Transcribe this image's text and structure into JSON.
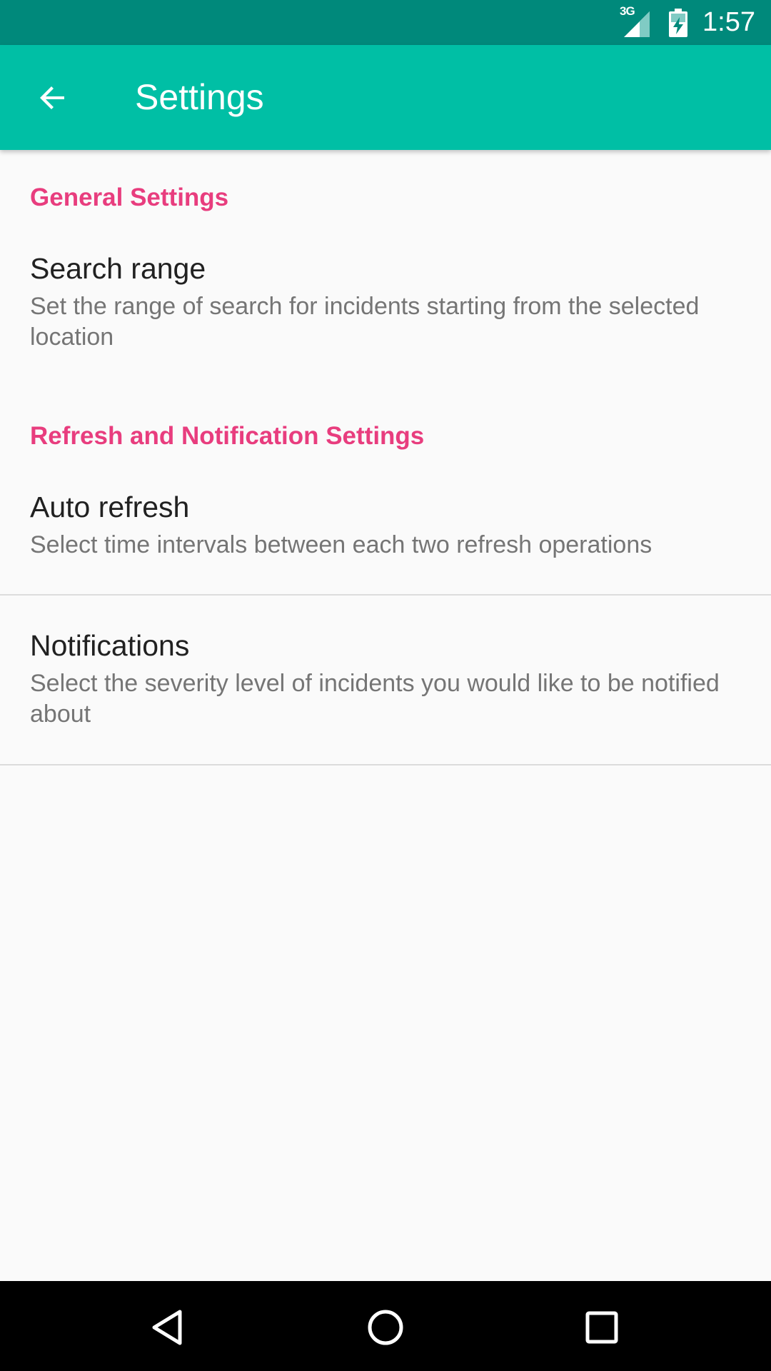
{
  "status_bar": {
    "network": "3G",
    "time": "1:57",
    "icons": [
      "signal-icon",
      "battery-charging-icon"
    ]
  },
  "app_bar": {
    "title": "Settings",
    "back_icon": "arrow-back-icon",
    "background": "#00bfa5",
    "status_background": "#00897b"
  },
  "sections": [
    {
      "header": "General Settings",
      "items": [
        {
          "title": "Search range",
          "summary": "Set the range of search for incidents starting from the selected location"
        }
      ]
    },
    {
      "header": "Refresh and Notification Settings",
      "items": [
        {
          "title": "Auto refresh",
          "summary": "Select time intervals between each two refresh operations"
        },
        {
          "title": "Notifications",
          "summary": "Select the severity level of incidents you would like to be notified about"
        }
      ]
    }
  ],
  "accent_color": "#e83d7e",
  "nav_bar": {
    "icons": [
      "back-triangle-icon",
      "home-circle-icon",
      "recents-square-icon"
    ]
  }
}
